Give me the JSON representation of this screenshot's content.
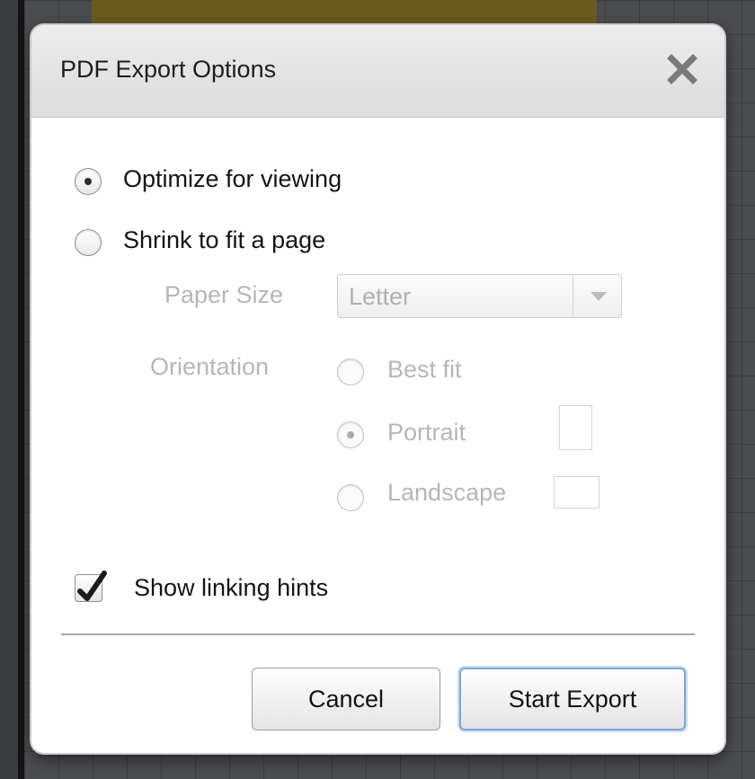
{
  "dialog": {
    "title": "PDF Export Options",
    "close_icon": "close-icon"
  },
  "options": {
    "optimize_label": "Optimize for viewing",
    "optimize_selected": true,
    "shrink_label": "Shrink to fit a page",
    "shrink_selected": false
  },
  "paper_size": {
    "label": "Paper Size",
    "value": "Letter",
    "enabled": false
  },
  "orientation": {
    "label": "Orientation",
    "enabled": false,
    "items": [
      {
        "label": "Best fit",
        "selected": false
      },
      {
        "label": "Portrait",
        "selected": true
      },
      {
        "label": "Landscape",
        "selected": false
      }
    ]
  },
  "show_linking_hints": {
    "label": "Show linking hints",
    "checked": true
  },
  "buttons": {
    "cancel": "Cancel",
    "start_export": "Start Export"
  },
  "colors": {
    "accent": "#7aa7d9",
    "disabled_text": "#b6b6b6"
  }
}
